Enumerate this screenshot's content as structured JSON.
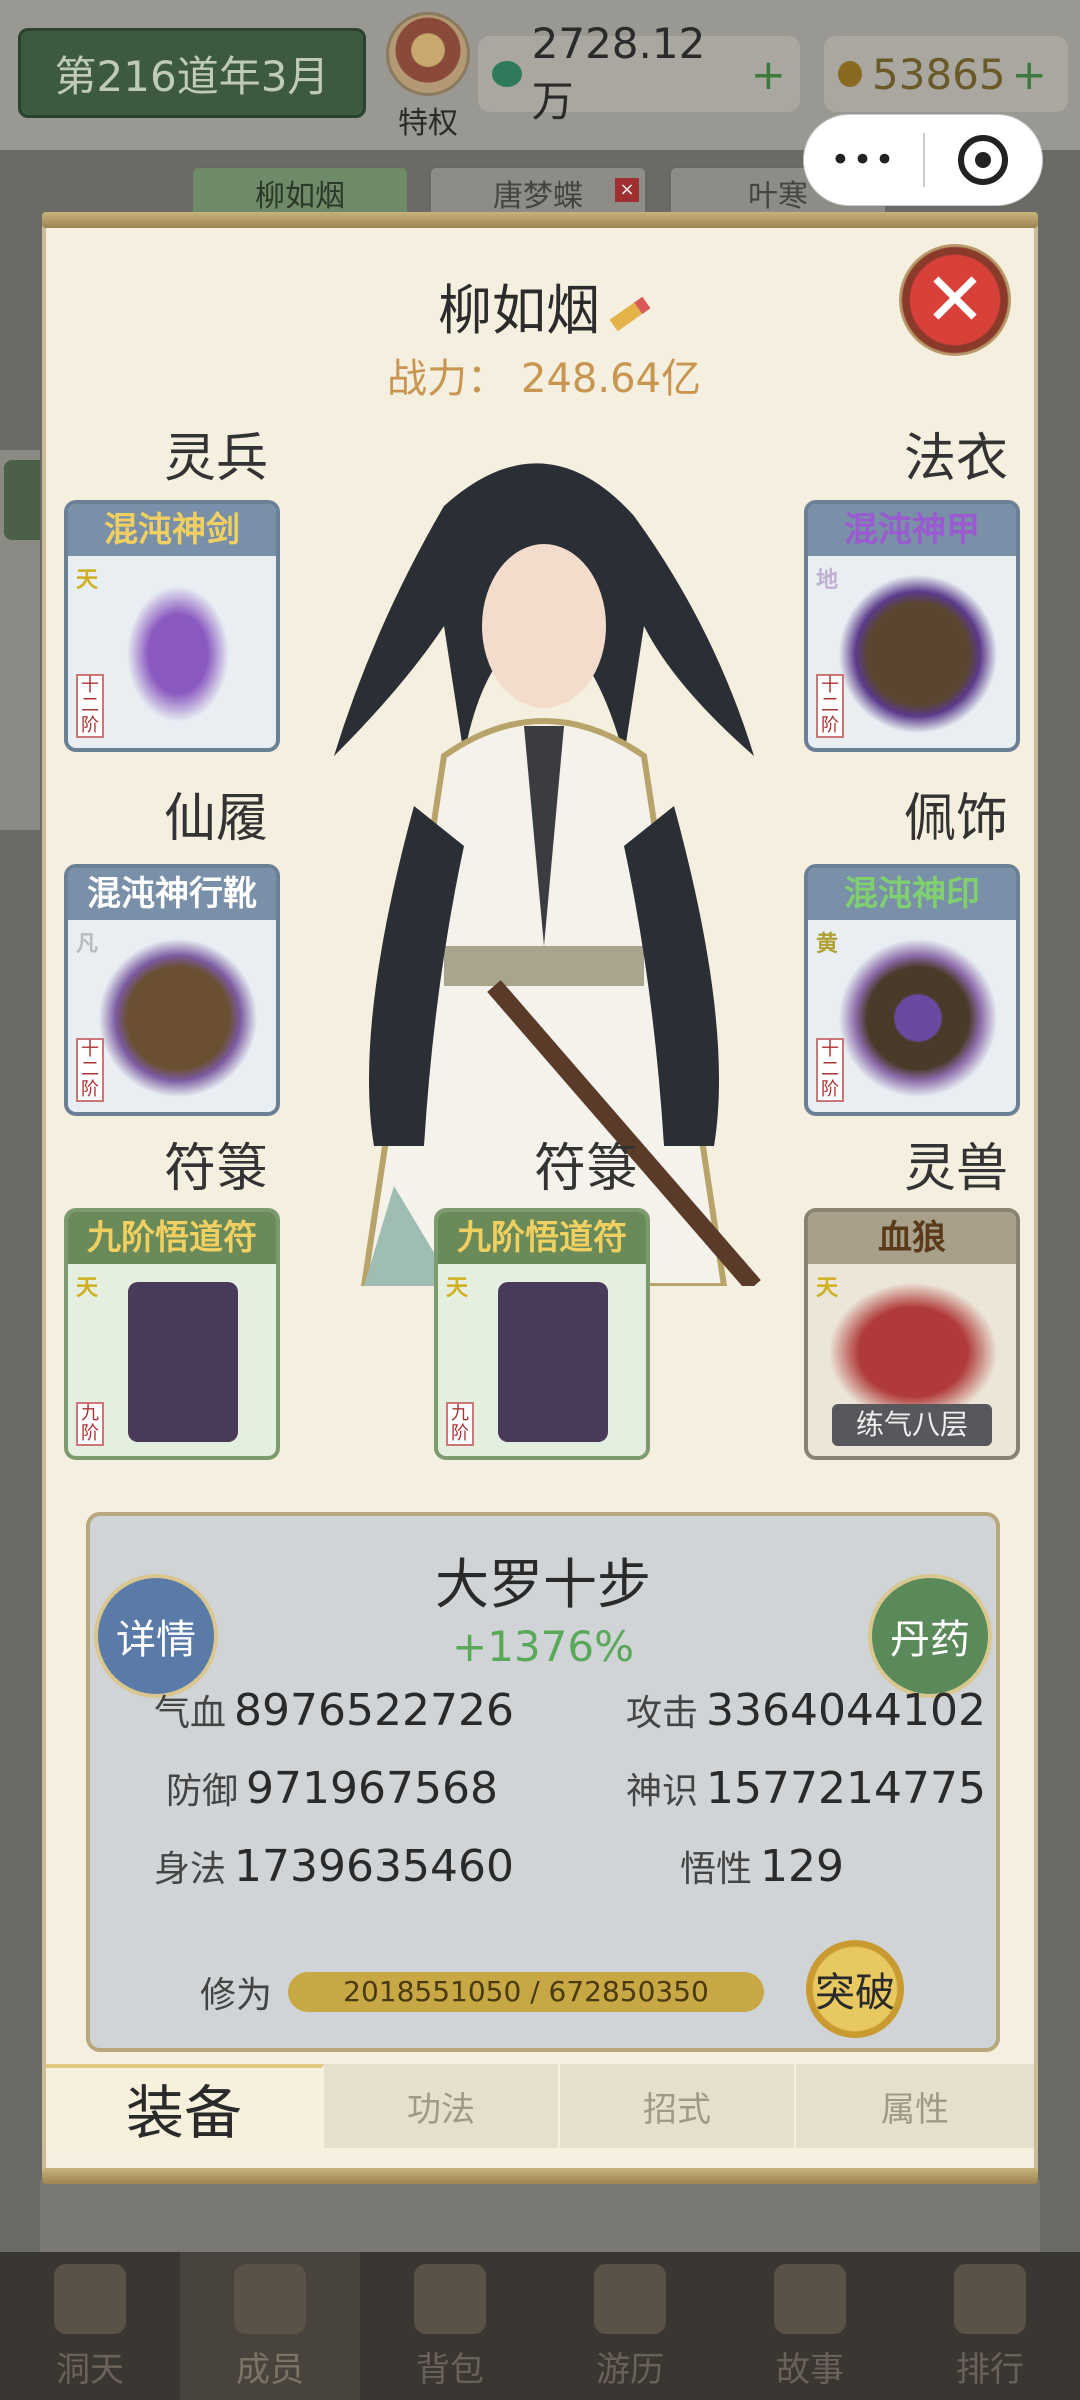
{
  "header": {
    "date": "第216道年3月",
    "vip_label": "特权",
    "jade": "2728.12万",
    "jade_plus": "+",
    "gold": "53865",
    "gold_plus": "+"
  },
  "capsule": {
    "more": "•••"
  },
  "char_tabs": [
    {
      "label": "柳如烟",
      "close": ""
    },
    {
      "label": "唐梦蝶",
      "close": "×"
    },
    {
      "label": "叶寒",
      "close": "×"
    }
  ],
  "character": {
    "name": "柳如烟",
    "power_label": "战力：",
    "power_value": "248.64亿",
    "close": "✕"
  },
  "slots": {
    "weapon": {
      "title": "灵兵",
      "item": "混沌神剑",
      "grade": "天",
      "tier": "十二阶",
      "color": "#f0d060",
      "art": "#6a3a8a"
    },
    "robe": {
      "title": "法衣",
      "item": "混沌神甲",
      "grade": "地",
      "tier": "十二阶",
      "color": "#9a5ad0",
      "art": "#4a3a2a"
    },
    "boots": {
      "title": "仙履",
      "item": "混沌神行靴",
      "grade": "凡",
      "tier": "十二阶",
      "color": "#ffffff",
      "art": "#6a5030"
    },
    "accessory": {
      "title": "佩饰",
      "item": "混沌神印",
      "grade": "黄",
      "tier": "十二阶",
      "color": "#80d070",
      "art": "#5a4a6a"
    },
    "talisman1": {
      "title": "符箓",
      "item": "九阶悟道符",
      "grade": "天",
      "tier": "九阶",
      "color": "#f0d060",
      "art": "#4a3a5a"
    },
    "talisman2": {
      "title": "符箓",
      "item": "九阶悟道符",
      "grade": "天",
      "tier": "九阶",
      "color": "#f0d060",
      "art": "#4a3a5a"
    },
    "beast": {
      "title": "灵兽",
      "item": "血狼",
      "grade": "天",
      "level": "练气八层",
      "color": "#5a3a18",
      "art": "#a03030"
    }
  },
  "stats": {
    "realm": "大罗十步",
    "bonus": "+1376%",
    "detail_btn": "详情",
    "pill_btn": "丹药",
    "hp_label": "气血",
    "hp": "8976522726",
    "atk_label": "攻击",
    "atk": "3364044102",
    "def_label": "防御",
    "def": "971967568",
    "spirit_label": "神识",
    "spirit": "1577214775",
    "agi_label": "身法",
    "agi": "1739635460",
    "wis_label": "悟性",
    "wis": "129",
    "cult_label": "修为",
    "cult_value": "2018551050 / 672850350",
    "break_btn": "突破"
  },
  "tabs": [
    "装备",
    "功法",
    "招式",
    "属性"
  ],
  "nav": [
    "洞天",
    "成员",
    "背包",
    "游历",
    "故事",
    "排行"
  ]
}
